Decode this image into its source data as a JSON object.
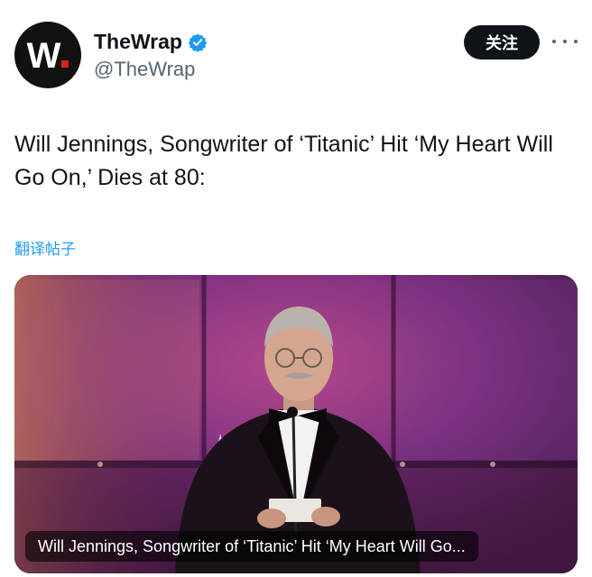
{
  "account": {
    "logo_text": "W",
    "display_name": "TheWrap",
    "handle": "@TheWrap",
    "verified_icon": "verified-badge-icon",
    "verified_color": "#1d9bf0"
  },
  "header": {
    "follow_label": "关注",
    "more_icon": "more-options-icon"
  },
  "tweet": {
    "text": "Will Jennings, Songwriter of ‘Titanic’ Hit ‘My Heart Will Go On,’ Dies at 80:",
    "translate_label": "翻译帖子"
  },
  "media": {
    "caption": "Will Jennings, Songwriter of ‘Titanic’ Hit ‘My Heart Will Go..."
  },
  "colors": {
    "accent": "#1d9bf0",
    "text": "#0f1419",
    "secondary": "#536471",
    "brand_red": "#e02020"
  }
}
